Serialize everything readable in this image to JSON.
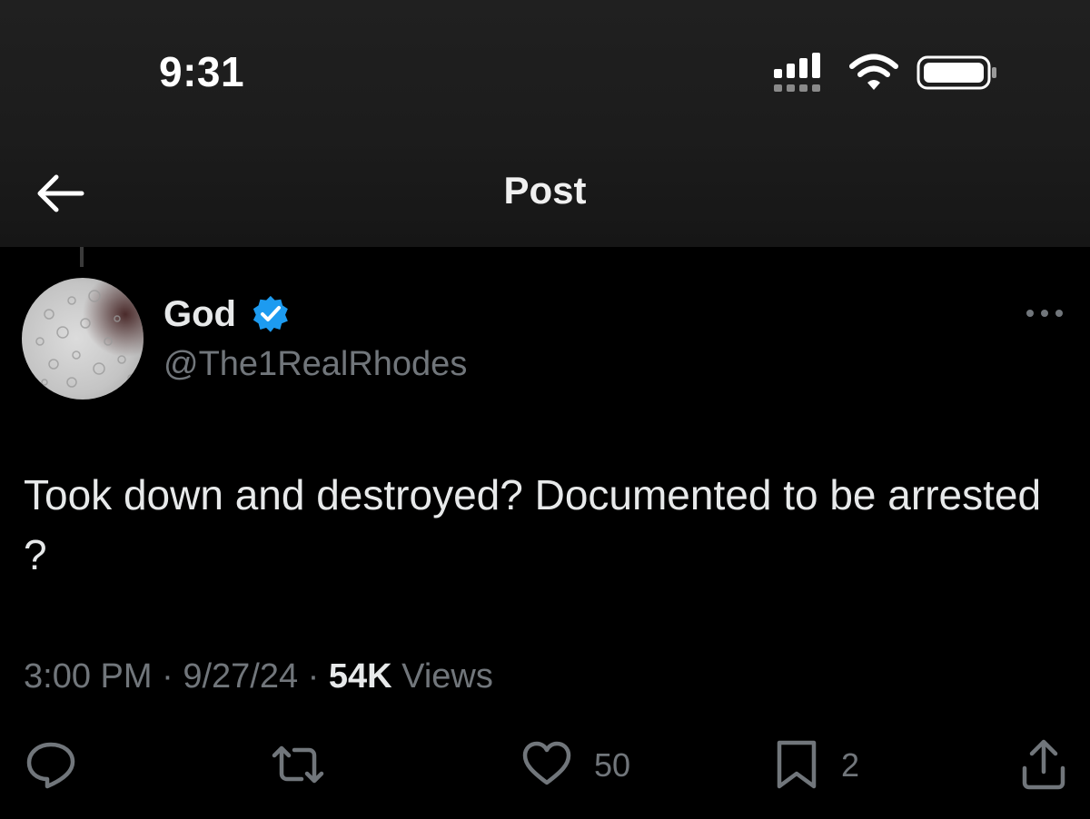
{
  "status_bar": {
    "time": "9:31"
  },
  "nav": {
    "back_icon": "arrow-left-icon",
    "title": "Post"
  },
  "post": {
    "author": {
      "display_name": "God",
      "handle": "@The1RealRhodes",
      "verified": true,
      "verified_color": "#1d9bf0"
    },
    "text": "Took down and destroyed? Documented to be arrested ?",
    "meta": {
      "time": "3:00 PM",
      "separator": "·",
      "date": "9/27/24",
      "views_count": "54K",
      "views_label": "Views"
    },
    "actions": {
      "reply": {
        "icon": "reply-icon",
        "count": ""
      },
      "repost": {
        "icon": "repost-icon",
        "count": ""
      },
      "like": {
        "icon": "heart-icon",
        "count": "50"
      },
      "bookmark": {
        "icon": "bookmark-icon",
        "count": "2"
      },
      "share": {
        "icon": "share-icon",
        "count": ""
      }
    }
  },
  "colors": {
    "background": "#000000",
    "primary_text": "#e7e9ea",
    "secondary_text": "#71767b",
    "accent": "#1d9bf0"
  }
}
